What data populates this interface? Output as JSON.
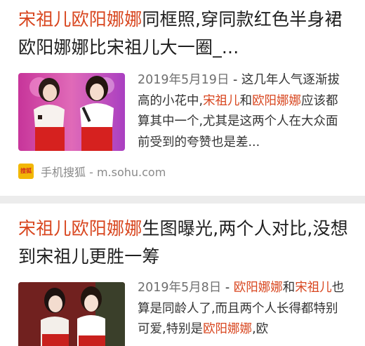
{
  "results": [
    {
      "title_parts": [
        {
          "text": "宋祖儿欧阳娜娜",
          "hl": true
        },
        {
          "text": "同框照,穿同款红色半身裙欧阳娜娜比宋祖儿大一圈_...",
          "hl": false
        }
      ],
      "snippet_parts": [
        {
          "text": "2019年5月19日",
          "kind": "date"
        },
        {
          "text": " - 这几年人气逐渐拔高的小花中,",
          "kind": "plain"
        },
        {
          "text": "宋祖儿",
          "kind": "hl"
        },
        {
          "text": "和",
          "kind": "plain"
        },
        {
          "text": "欧阳娜娜",
          "kind": "hl"
        },
        {
          "text": "应该都算其中一个,尤其是这两个人在大众面前受到的夸赞也是差...",
          "kind": "plain"
        }
      ],
      "source": {
        "logo_text": "搜狐",
        "label": "手机搜狐 - m.sohu.com"
      }
    },
    {
      "title_parts": [
        {
          "text": "宋祖儿欧阳娜娜",
          "hl": true
        },
        {
          "text": "生图曝光,两个人对比,没想到宋祖儿更胜一筹",
          "hl": false
        }
      ],
      "snippet_parts": [
        {
          "text": "2019年5月8日",
          "kind": "date"
        },
        {
          "text": " - ",
          "kind": "plain"
        },
        {
          "text": "欧阳娜娜",
          "kind": "hl"
        },
        {
          "text": "和",
          "kind": "plain"
        },
        {
          "text": "宋祖儿",
          "kind": "hl"
        },
        {
          "text": "也算是同龄人了,而且两个人长得都特别可爱,特别是",
          "kind": "plain"
        },
        {
          "text": "欧阳娜娜",
          "kind": "hl"
        },
        {
          "text": ",欧",
          "kind": "plain"
        }
      ]
    }
  ],
  "colors": {
    "highlight": "#d8461f",
    "text": "#1f1f1f",
    "date": "#6f6f6f",
    "separator": "#ececec"
  }
}
